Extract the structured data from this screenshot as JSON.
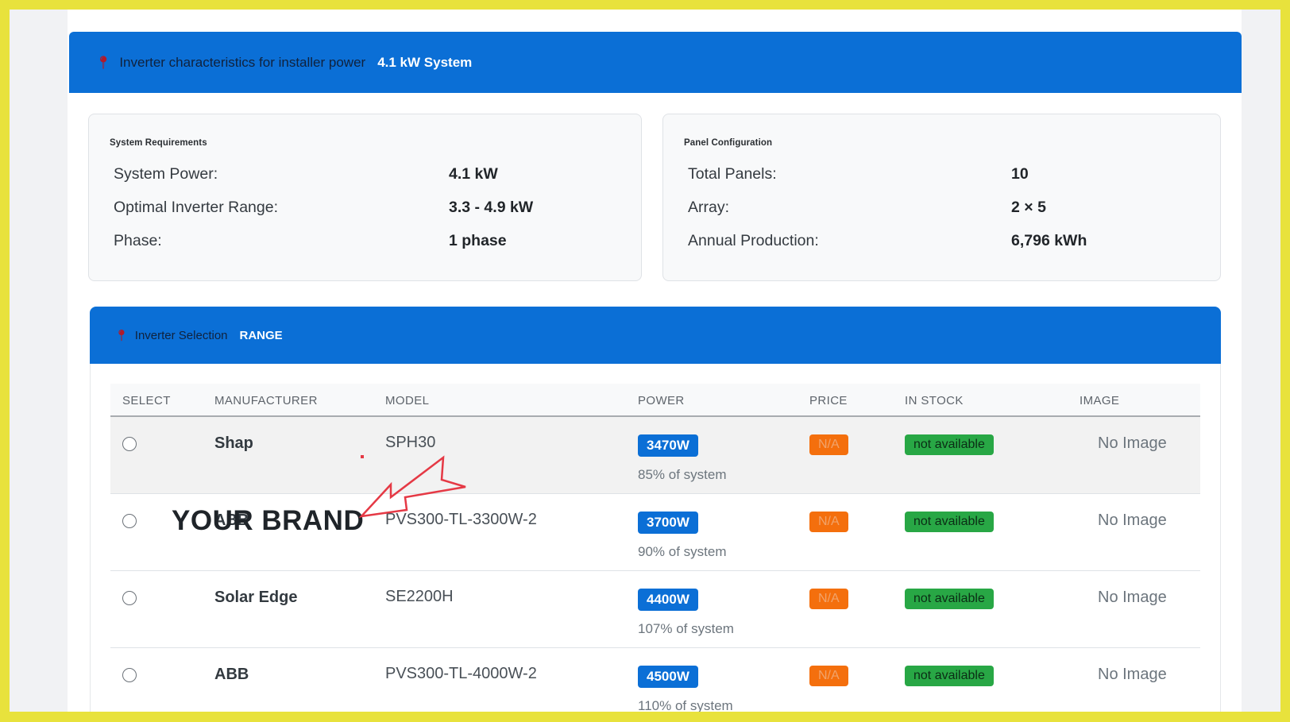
{
  "header": {
    "label": "Inverter characteristics for installer power",
    "value": "4.1 kW System",
    "icon": "pin-icon"
  },
  "requirements": {
    "title": "System Requirements",
    "rows": [
      {
        "key": "System Power:",
        "value": "4.1 kW"
      },
      {
        "key": "Optimal Inverter Range:",
        "value": "3.3 - 4.9 kW"
      },
      {
        "key": "Phase:",
        "value": "1 phase"
      }
    ]
  },
  "panels": {
    "title": "Panel Configuration",
    "rows": [
      {
        "key": "Total Panels:",
        "value": "10"
      },
      {
        "key": "Array:",
        "value": "2 × 5"
      },
      {
        "key": "Annual Production:",
        "value": "6,796 kWh"
      }
    ]
  },
  "selection": {
    "label": "Inverter Selection",
    "value": "RANGE",
    "columns": [
      "SELECT",
      "MANUFACTURER",
      "MODEL",
      "POWER",
      "PRICE",
      "IN STOCK",
      "IMAGE"
    ],
    "rows": [
      {
        "manufacturer": "Shap",
        "model": "SPH30",
        "power": "3470W",
        "percent": "85% of system",
        "price": "N/A",
        "stock": "not available",
        "image": "No Image"
      },
      {
        "manufacturer": "ABB",
        "model": "PVS300-TL-3300W-2",
        "power": "3700W",
        "percent": "90% of system",
        "price": "N/A",
        "stock": "not available",
        "image": "No Image"
      },
      {
        "manufacturer": "Solar Edge",
        "model": "SE2200H",
        "power": "4400W",
        "percent": "107% of system",
        "price": "N/A",
        "stock": "not available",
        "image": "No Image"
      },
      {
        "manufacturer": "ABB",
        "model": "PVS300-TL-4000W-2",
        "power": "4500W",
        "percent": "110% of system",
        "price": "N/A",
        "stock": "not available",
        "image": "No Image"
      }
    ]
  },
  "overlay": {
    "brand_text": "YOUR BRAND",
    "arrow_color": "#e53945",
    "frame_color": "#e8e23c"
  },
  "colors": {
    "primary": "#0b6fd6",
    "price_badge": "#f46f0d",
    "stock_badge": "#28a745"
  }
}
